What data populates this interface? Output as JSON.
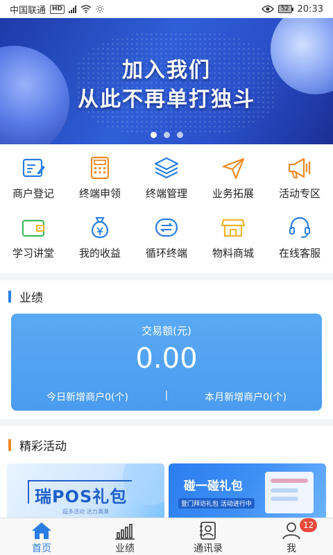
{
  "status_bar": {
    "carrier": "中国联通",
    "hd": "HD",
    "network": "4G",
    "battery": "52",
    "time": "20:33"
  },
  "banner": {
    "line1": "加入我们",
    "line2": "从此不再单打独斗",
    "active_slide": 1,
    "slide_count": 3
  },
  "menu": [
    {
      "label": "商户登记",
      "icon": "register-icon",
      "color": "#2a7de1"
    },
    {
      "label": "终端申领",
      "icon": "calculator-icon",
      "color": "#f08a24"
    },
    {
      "label": "终端管理",
      "icon": "layers-icon",
      "color": "#2a7de1"
    },
    {
      "label": "业务拓展",
      "icon": "send-icon",
      "color": "#f08a24"
    },
    {
      "label": "活动专区",
      "icon": "megaphone-icon",
      "color": "#f08a24"
    },
    {
      "label": "学习讲堂",
      "icon": "wallet-icon",
      "color": "#3dbb5a"
    },
    {
      "label": "我的收益",
      "icon": "money-bag-icon",
      "color": "#2a7de1"
    },
    {
      "label": "循环终端",
      "icon": "cycle-icon",
      "color": "#2a7de1"
    },
    {
      "label": "物料商城",
      "icon": "shop-icon",
      "color": "#f0b428"
    },
    {
      "label": "在线客服",
      "icon": "headset-icon",
      "color": "#2a7de1"
    }
  ],
  "performance": {
    "title": "业绩",
    "amount_label": "交易额(元)",
    "amount": "0.00",
    "today_new": "今日新增商户0(个)",
    "separator": "|",
    "month_new": "本月新增商户0(个)"
  },
  "activities": {
    "title": "精彩活动",
    "promo1_title": "瑞POS礼包",
    "promo1_sub": "超多活动 活力满满",
    "promo2_title": "碰一碰礼包",
    "promo2_sub": "登门拜访礼包 活动进行中"
  },
  "nav": [
    {
      "label": "首页",
      "icon": "home-icon",
      "active": true
    },
    {
      "label": "业绩",
      "icon": "bar-chart-icon",
      "active": false
    },
    {
      "label": "通讯录",
      "icon": "contacts-icon",
      "active": false
    },
    {
      "label": "我",
      "icon": "user-icon",
      "active": false,
      "badge": "12"
    }
  ],
  "colors": {
    "primary": "#2a7de1",
    "accent": "#f08a24",
    "badge": "#e84a3c"
  }
}
